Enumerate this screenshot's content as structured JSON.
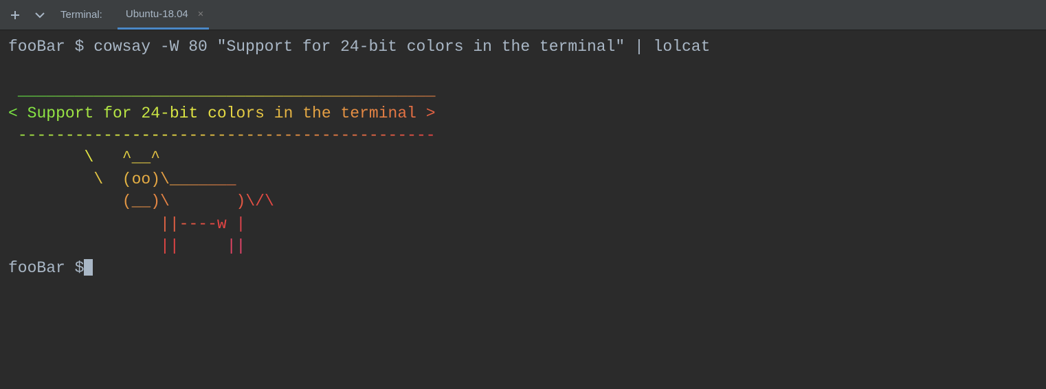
{
  "titlebar": {
    "label": "Terminal:",
    "tab_name": "Ubuntu-18.04"
  },
  "terminal": {
    "prompt": "fooBar $",
    "command": " cowsay -W 80 \"Support for 24-bit colors in the terminal\" | lolcat",
    "blank": "",
    "output": {
      "line1": " ____________________________________________",
      "line2": "< Support for 24-bit colors in the terminal >",
      "line3": " --------------------------------------------",
      "line4": "        \\   ^__^",
      "line5": "         \\  (oo)\\_______",
      "line6": "            (__)\\       )\\/\\",
      "line7": "                ||----w |",
      "line8": "                ||     ||"
    },
    "prompt2": "fooBar $"
  }
}
